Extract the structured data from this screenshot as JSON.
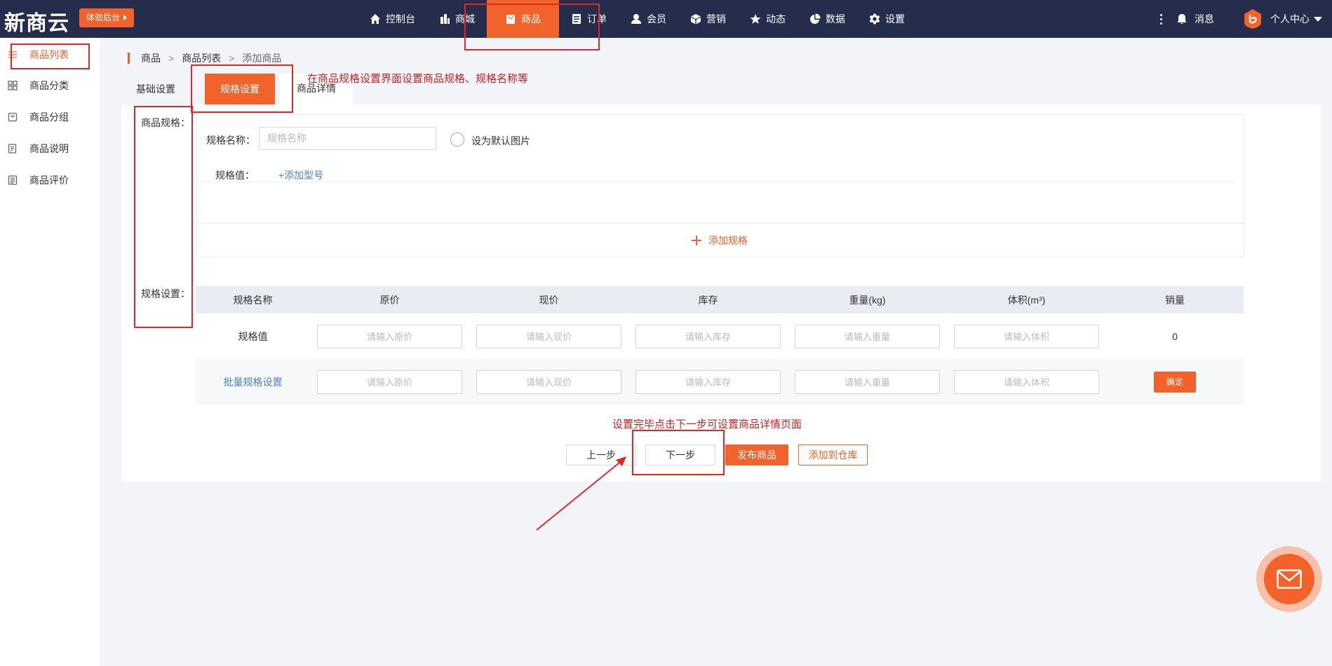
{
  "brand": {
    "logo": "新商云",
    "trial_button": "体验后台"
  },
  "nav": {
    "items": [
      {
        "label": "控制台",
        "icon": "home-icon"
      },
      {
        "label": "商城",
        "icon": "building-icon"
      },
      {
        "label": "商品",
        "icon": "bag-icon",
        "active": true
      },
      {
        "label": "订单",
        "icon": "document-icon"
      },
      {
        "label": "会员",
        "icon": "user-icon"
      },
      {
        "label": "营销",
        "icon": "cube-icon"
      },
      {
        "label": "动态",
        "icon": "star-icon"
      },
      {
        "label": "数据",
        "icon": "pie-chart-icon"
      },
      {
        "label": "设置",
        "icon": "gear-icon"
      }
    ],
    "message": "消息",
    "user_center": "个人中心"
  },
  "sidebar": {
    "items": [
      {
        "label": "商品列表",
        "icon": "list-icon",
        "active": true
      },
      {
        "label": "商品分类",
        "icon": "grid-icon"
      },
      {
        "label": "商品分组",
        "icon": "tag-icon"
      },
      {
        "label": "商品说明",
        "icon": "note-icon"
      },
      {
        "label": "商品评价",
        "icon": "review-icon"
      }
    ]
  },
  "breadcrumb": {
    "level1": "商品",
    "level2": "商品列表",
    "current": "添加商品",
    "separator": ">"
  },
  "tabs": {
    "basic": "基础设置",
    "spec": "规格设置",
    "detail": "商品详情"
  },
  "form": {
    "spec_label": "商品规格：",
    "spec_setting_label": "规格设置：",
    "spec_name_label": "规格名称：",
    "spec_name_placeholder": "规格名称",
    "default_image_label": "设为默认图片",
    "spec_value_label": "规格值：",
    "add_model_link": "+添加型号",
    "add_spec_button": "添加规格"
  },
  "table": {
    "headers": [
      "规格名称",
      "原价",
      "现价",
      "库存",
      "重量(kg)",
      "体积(m³)",
      "销量"
    ],
    "row1": {
      "name": "规格值",
      "placeholders": [
        "请输入原价",
        "请输入现价",
        "请输入库存",
        "请输入重量",
        "请输入体积"
      ],
      "sales": "0"
    },
    "row2": {
      "name": "批量规格设置",
      "placeholders": [
        "请输入原价",
        "请输入现价",
        "请输入库存",
        "请输入重量",
        "请输入体积"
      ],
      "confirm": "确定"
    }
  },
  "buttons": {
    "prev": "上一步",
    "next": "下一步",
    "publish": "发布商品",
    "storage": "添加到仓库"
  },
  "annotations": {
    "tab_note": "在商品规格设置界面设置商品规格、规格名称等",
    "next_note": "设置完毕点击下一步可设置商品详情页面"
  },
  "colors": {
    "accent": "#f2622b",
    "topbar": "#262c4c",
    "link": "#4a84c9",
    "annotation": "#e32626"
  }
}
